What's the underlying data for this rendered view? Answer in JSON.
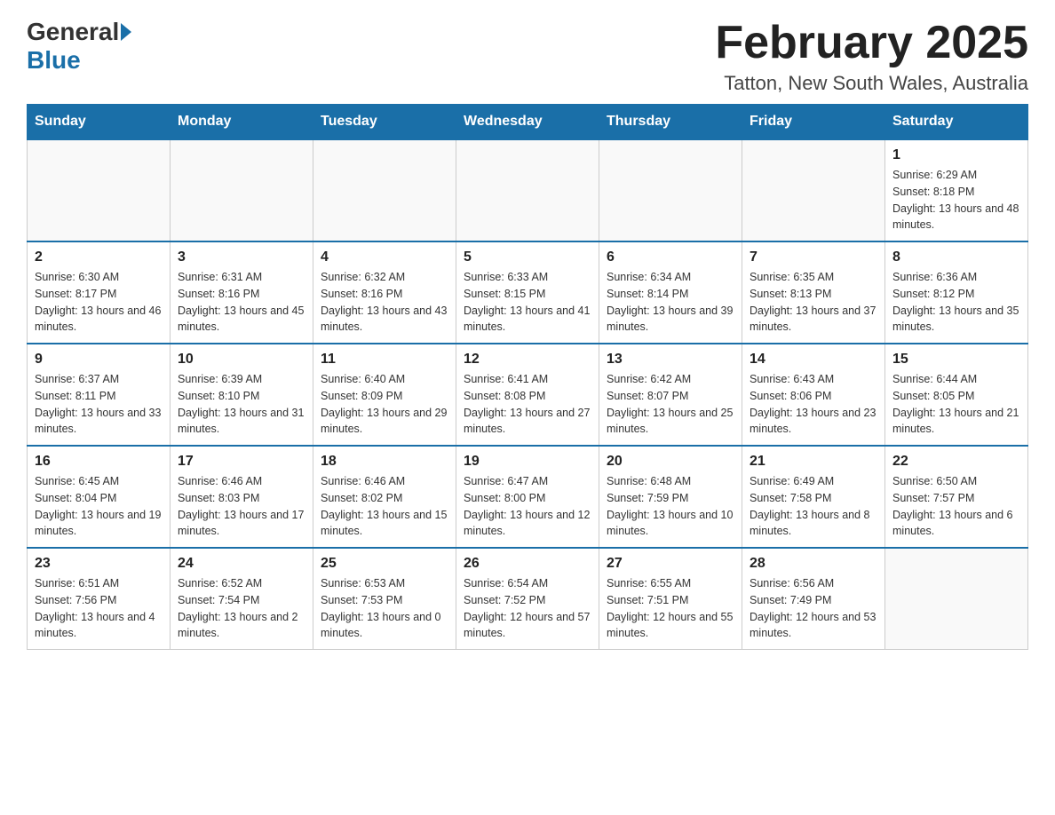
{
  "header": {
    "logo_general": "General",
    "logo_blue": "Blue",
    "title": "February 2025",
    "location": "Tatton, New South Wales, Australia"
  },
  "days_of_week": [
    "Sunday",
    "Monday",
    "Tuesday",
    "Wednesday",
    "Thursday",
    "Friday",
    "Saturday"
  ],
  "weeks": [
    [
      {
        "day": "",
        "info": ""
      },
      {
        "day": "",
        "info": ""
      },
      {
        "day": "",
        "info": ""
      },
      {
        "day": "",
        "info": ""
      },
      {
        "day": "",
        "info": ""
      },
      {
        "day": "",
        "info": ""
      },
      {
        "day": "1",
        "info": "Sunrise: 6:29 AM\nSunset: 8:18 PM\nDaylight: 13 hours and 48 minutes."
      }
    ],
    [
      {
        "day": "2",
        "info": "Sunrise: 6:30 AM\nSunset: 8:17 PM\nDaylight: 13 hours and 46 minutes."
      },
      {
        "day": "3",
        "info": "Sunrise: 6:31 AM\nSunset: 8:16 PM\nDaylight: 13 hours and 45 minutes."
      },
      {
        "day": "4",
        "info": "Sunrise: 6:32 AM\nSunset: 8:16 PM\nDaylight: 13 hours and 43 minutes."
      },
      {
        "day": "5",
        "info": "Sunrise: 6:33 AM\nSunset: 8:15 PM\nDaylight: 13 hours and 41 minutes."
      },
      {
        "day": "6",
        "info": "Sunrise: 6:34 AM\nSunset: 8:14 PM\nDaylight: 13 hours and 39 minutes."
      },
      {
        "day": "7",
        "info": "Sunrise: 6:35 AM\nSunset: 8:13 PM\nDaylight: 13 hours and 37 minutes."
      },
      {
        "day": "8",
        "info": "Sunrise: 6:36 AM\nSunset: 8:12 PM\nDaylight: 13 hours and 35 minutes."
      }
    ],
    [
      {
        "day": "9",
        "info": "Sunrise: 6:37 AM\nSunset: 8:11 PM\nDaylight: 13 hours and 33 minutes."
      },
      {
        "day": "10",
        "info": "Sunrise: 6:39 AM\nSunset: 8:10 PM\nDaylight: 13 hours and 31 minutes."
      },
      {
        "day": "11",
        "info": "Sunrise: 6:40 AM\nSunset: 8:09 PM\nDaylight: 13 hours and 29 minutes."
      },
      {
        "day": "12",
        "info": "Sunrise: 6:41 AM\nSunset: 8:08 PM\nDaylight: 13 hours and 27 minutes."
      },
      {
        "day": "13",
        "info": "Sunrise: 6:42 AM\nSunset: 8:07 PM\nDaylight: 13 hours and 25 minutes."
      },
      {
        "day": "14",
        "info": "Sunrise: 6:43 AM\nSunset: 8:06 PM\nDaylight: 13 hours and 23 minutes."
      },
      {
        "day": "15",
        "info": "Sunrise: 6:44 AM\nSunset: 8:05 PM\nDaylight: 13 hours and 21 minutes."
      }
    ],
    [
      {
        "day": "16",
        "info": "Sunrise: 6:45 AM\nSunset: 8:04 PM\nDaylight: 13 hours and 19 minutes."
      },
      {
        "day": "17",
        "info": "Sunrise: 6:46 AM\nSunset: 8:03 PM\nDaylight: 13 hours and 17 minutes."
      },
      {
        "day": "18",
        "info": "Sunrise: 6:46 AM\nSunset: 8:02 PM\nDaylight: 13 hours and 15 minutes."
      },
      {
        "day": "19",
        "info": "Sunrise: 6:47 AM\nSunset: 8:00 PM\nDaylight: 13 hours and 12 minutes."
      },
      {
        "day": "20",
        "info": "Sunrise: 6:48 AM\nSunset: 7:59 PM\nDaylight: 13 hours and 10 minutes."
      },
      {
        "day": "21",
        "info": "Sunrise: 6:49 AM\nSunset: 7:58 PM\nDaylight: 13 hours and 8 minutes."
      },
      {
        "day": "22",
        "info": "Sunrise: 6:50 AM\nSunset: 7:57 PM\nDaylight: 13 hours and 6 minutes."
      }
    ],
    [
      {
        "day": "23",
        "info": "Sunrise: 6:51 AM\nSunset: 7:56 PM\nDaylight: 13 hours and 4 minutes."
      },
      {
        "day": "24",
        "info": "Sunrise: 6:52 AM\nSunset: 7:54 PM\nDaylight: 13 hours and 2 minutes."
      },
      {
        "day": "25",
        "info": "Sunrise: 6:53 AM\nSunset: 7:53 PM\nDaylight: 13 hours and 0 minutes."
      },
      {
        "day": "26",
        "info": "Sunrise: 6:54 AM\nSunset: 7:52 PM\nDaylight: 12 hours and 57 minutes."
      },
      {
        "day": "27",
        "info": "Sunrise: 6:55 AM\nSunset: 7:51 PM\nDaylight: 12 hours and 55 minutes."
      },
      {
        "day": "28",
        "info": "Sunrise: 6:56 AM\nSunset: 7:49 PM\nDaylight: 12 hours and 53 minutes."
      },
      {
        "day": "",
        "info": ""
      }
    ]
  ]
}
